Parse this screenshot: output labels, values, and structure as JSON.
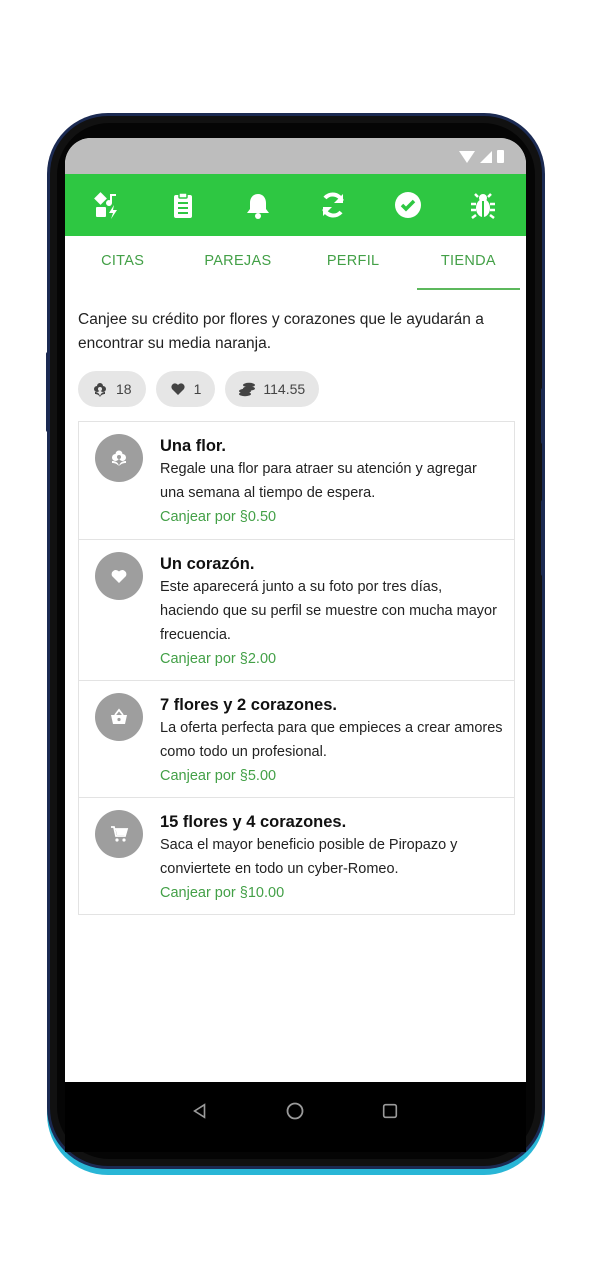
{
  "colors": {
    "accent": "#2ec742",
    "tab_text": "#43a047",
    "action": "#43a047",
    "avatar_bg": "#9e9e9e"
  },
  "appbar": {
    "icons": [
      "shapes-icon",
      "clipboard-icon",
      "bell-icon",
      "sync-icon",
      "check-circle-icon",
      "bug-icon"
    ]
  },
  "tabs": [
    {
      "label": "CITAS",
      "active": false
    },
    {
      "label": "PAREJAS",
      "active": false
    },
    {
      "label": "PERFIL",
      "active": false
    },
    {
      "label": "TIENDA",
      "active": true
    }
  ],
  "intro": "Canjee su crédito por flores y corazones que le ayudarán a encontrar su media naranja.",
  "chips": [
    {
      "icon": "flower-icon",
      "value": "18"
    },
    {
      "icon": "heart-icon",
      "value": "1"
    },
    {
      "icon": "coins-icon",
      "value": "114.55"
    }
  ],
  "items": [
    {
      "icon": "flower-icon",
      "title": "Una flor.",
      "desc": "Regale una flor para atraer su atención y agregar una semana al tiempo de espera.",
      "action": "Canjear por §0.50"
    },
    {
      "icon": "heart-icon",
      "title": "Un corazón.",
      "desc": "Este aparecerá junto a su foto por tres días, haciendo que su perfil se muestre con mucha mayor frecuencia.",
      "action": "Canjear por §2.00"
    },
    {
      "icon": "basket-icon",
      "title": "7 flores y 2 corazones.",
      "desc": "La oferta perfecta para que empieces a crear amores como todo un profesional.",
      "action": "Canjear por §5.00"
    },
    {
      "icon": "cart-icon",
      "title": "15 flores y 4 corazones.",
      "desc": "Saca el mayor beneficio posible de Piropazo y conviertete en todo un cyber-Romeo.",
      "action": "Canjear por §10.00"
    }
  ],
  "navbar": {
    "icons": [
      "back-icon",
      "home-icon",
      "recents-icon"
    ]
  }
}
